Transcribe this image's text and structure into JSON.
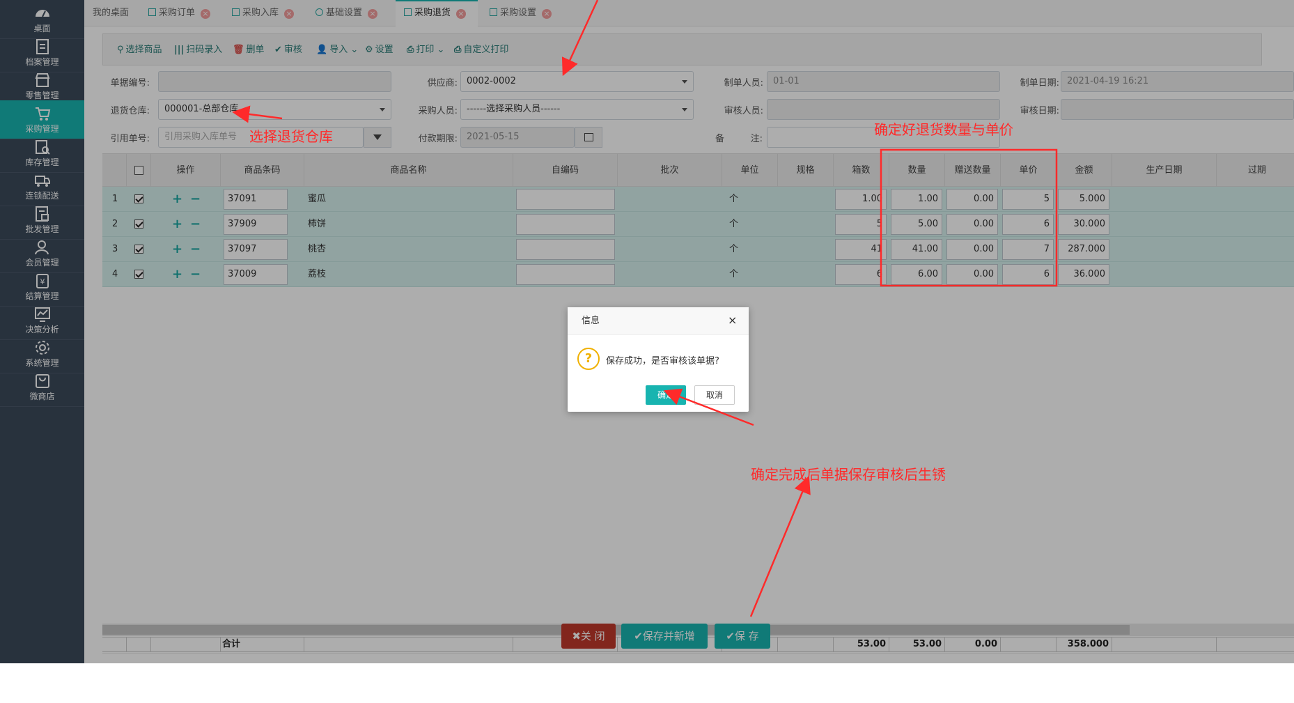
{
  "sidebar": {
    "items": [
      {
        "label": "桌面",
        "icon": "dashboard-icon"
      },
      {
        "label": "档案管理",
        "icon": "file-icon"
      },
      {
        "label": "零售管理",
        "icon": "store-icon"
      },
      {
        "label": "采购管理",
        "icon": "cart-icon"
      },
      {
        "label": "库存管理",
        "icon": "inventory-icon"
      },
      {
        "label": "连锁配送",
        "icon": "truck-icon"
      },
      {
        "label": "批发管理",
        "icon": "wholesale-icon"
      },
      {
        "label": "会员管理",
        "icon": "member-icon"
      },
      {
        "label": "结算管理",
        "icon": "settlement-icon"
      },
      {
        "label": "决策分析",
        "icon": "chart-icon"
      },
      {
        "label": "系统管理",
        "icon": "gear-icon"
      },
      {
        "label": "微商店",
        "icon": "shop-bag-icon"
      }
    ]
  },
  "tabs": [
    {
      "label": "我的桌面"
    },
    {
      "label": "采购订单"
    },
    {
      "label": "采购入库"
    },
    {
      "label": "基础设置"
    },
    {
      "label": "采购退货"
    },
    {
      "label": "采购设置"
    }
  ],
  "toolbar": {
    "select_goods": "选择商品",
    "scan_entry": "扫码录入",
    "delete": "删单",
    "audit": "审核",
    "import": "导入",
    "settings": "设置",
    "print": "打印",
    "custom_print": "自定义打印"
  },
  "form": {
    "doc_no_label": "单据编号:",
    "doc_no_value": "",
    "supplier_label": "供应商:",
    "supplier_value": "0002-0002",
    "maker_label": "制单人员:",
    "maker_value": "01-01",
    "make_date_label": "制单日期:",
    "make_date_value": "2021-04-19 16:21",
    "warehouse_label": "退货仓库:",
    "warehouse_value": "000001-总部仓库",
    "buyer_label": "采购人员:",
    "buyer_value": "------选择采购人员------",
    "auditor_label": "审核人员:",
    "auditor_value": "",
    "audit_date_label": "审核日期:",
    "audit_date_value": "",
    "ref_no_label": "引用单号:",
    "ref_no_placeholder": "引用采购入库单号",
    "pay_due_label": "付款期限:",
    "pay_due_value": "2021-05-15",
    "remark_label_a": "备",
    "remark_label_b": "注:",
    "remark_value": ""
  },
  "grid": {
    "headers": [
      "操作",
      "商品条码",
      "商品名称",
      "自编码",
      "批次",
      "单位",
      "规格",
      "箱数",
      "数量",
      "赠送数量",
      "单价",
      "金额",
      "生产日期",
      "过期"
    ],
    "rows": [
      {
        "no": "1",
        "barcode": "37091",
        "name": "蜜瓜",
        "code": "",
        "batch": "",
        "unit": "个",
        "spec": "",
        "boxes": "1.00",
        "qty": "1.00",
        "gift": "0.00",
        "price": "5",
        "amount": "5.000"
      },
      {
        "no": "2",
        "barcode": "37909",
        "name": "柿饼",
        "code": "",
        "batch": "",
        "unit": "个",
        "spec": "",
        "boxes": "5",
        "qty": "5.00",
        "gift": "0.00",
        "price": "6",
        "amount": "30.000"
      },
      {
        "no": "3",
        "barcode": "37097",
        "name": "桃杏",
        "code": "",
        "batch": "",
        "unit": "个",
        "spec": "",
        "boxes": "41",
        "qty": "41.00",
        "gift": "0.00",
        "price": "7",
        "amount": "287.000"
      },
      {
        "no": "4",
        "barcode": "37009",
        "name": "荔枝",
        "code": "",
        "batch": "",
        "unit": "个",
        "spec": "",
        "boxes": "6",
        "qty": "6.00",
        "gift": "0.00",
        "price": "6",
        "amount": "36.000"
      }
    ],
    "plus": "+",
    "minus": "−",
    "totals": {
      "label": "合计",
      "boxes": "53.00",
      "qty": "53.00",
      "gift": "0.00",
      "amount": "358.000"
    }
  },
  "actions": {
    "close": "关 闭",
    "save_new": "保存并新增",
    "save": "保 存"
  },
  "dialog": {
    "title": "信息",
    "close": "×",
    "icon_glyph": "?",
    "message": "保存成功，是否审核该单据?",
    "ok": "确定",
    "cancel": "取消"
  },
  "annotations": {
    "warehouse": "选择退货仓库",
    "qty_price": "确定好退货数量与单价",
    "after_confirm": "确定完成后单据保存审核后生锈"
  },
  "colors": {
    "accent": "#18b4b0",
    "sidebar": "#3c4a5b",
    "annotation": "#ff2a2a",
    "close_button": "#c0392b"
  }
}
